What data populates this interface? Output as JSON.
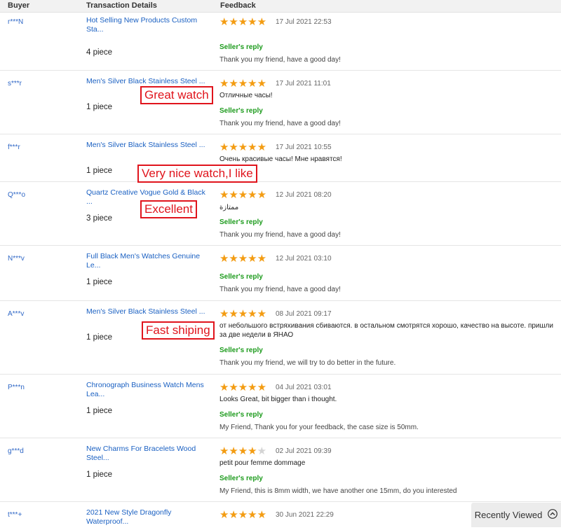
{
  "header": {
    "buyer": "Buyer",
    "details": "Transaction Details",
    "feedback": "Feedback"
  },
  "reviews": [
    {
      "buyer": "r***N",
      "product": "Hot Selling New Products Custom Sta...",
      "qty": "4 piece",
      "rating": 5,
      "date": "17 Jul 2021 22:53",
      "comment": "",
      "reply_label": "Seller's reply",
      "reply": "Thank you my friend, have a good day!"
    },
    {
      "buyer": "s***r",
      "product": "Men's Silver Black Stainless Steel ...",
      "qty": "1 piece",
      "rating": 5,
      "date": "17 Jul 2021 11:01",
      "comment": "Отличные часы!",
      "reply_label": "Seller's reply",
      "reply": "Thank you my friend, have a good day!"
    },
    {
      "buyer": "f***r",
      "product": "Men's Silver Black Stainless Steel ...",
      "qty": "1 piece",
      "rating": 5,
      "date": "17 Jul 2021 10:55",
      "comment": "Очень красивые часы! Мне нравятся!",
      "reply_label": "",
      "reply": ""
    },
    {
      "buyer": "Q***o",
      "product": "Quartz Creative Vogue Gold & Black ...",
      "qty": "3 piece",
      "rating": 5,
      "date": "12 Jul 2021 08:20",
      "comment": "ممتازة",
      "reply_label": "Seller's reply",
      "reply": "Thank you my friend, have a good day!"
    },
    {
      "buyer": "N***v",
      "product": "Full Black Men's Watches Genuine Le...",
      "qty": "1 piece",
      "rating": 5,
      "date": "12 Jul 2021 03:10",
      "comment": "",
      "reply_label": "Seller's reply",
      "reply": "Thank you my friend, have a good day!"
    },
    {
      "buyer": "A***v",
      "product": "Men's Silver Black Stainless Steel ...",
      "qty": "1 piece",
      "rating": 5,
      "date": "08 Jul 2021 09:17",
      "comment": "от небольшого встряхивания сбиваются. в остальном смотрятся хорошо, качество на высоте. пришли за две недели в ЯНАО",
      "reply_label": "Seller's reply",
      "reply": "Thank you my friend, we will try to do better in the future."
    },
    {
      "buyer": "P***n",
      "product": "Chronograph Business Watch Mens Lea...",
      "qty": "1 piece",
      "rating": 5,
      "date": "04 Jul 2021 03:01",
      "comment": "Looks Great, bit bigger than i thought.",
      "reply_label": "Seller's reply",
      "reply": "My Friend, Thank you for your feedback, the case size is 50mm."
    },
    {
      "buyer": "g***d",
      "product": "New Charms For Bracelets Wood Steel...",
      "qty": "1 piece",
      "rating": 4,
      "date": "02 Jul 2021 09:39",
      "comment": "petit pour femme dommage",
      "reply_label": "Seller's reply",
      "reply": "My Friend, this is 8mm width, we have another one 15mm, do you interested"
    },
    {
      "buyer": "t***+",
      "product": "2021 New Style Dragonfly Waterproof...",
      "qty": "",
      "rating": 5,
      "date": "30 Jun 2021 22:29",
      "comment": "",
      "reply_label": "",
      "reply": ""
    }
  ],
  "annotations": [
    "Great watch",
    "Very nice watch,I like",
    "Excellent",
    "Fast shiping"
  ],
  "recently_viewed": {
    "label": "Recently Viewed",
    "icon": "chevron-up-circle-icon"
  },
  "colors": {
    "star": "#f39c12",
    "star_off": "#d4d4d4",
    "reply_label": "#1d9b1d",
    "link": "#1a60c2",
    "annotation": "#e0141c"
  }
}
